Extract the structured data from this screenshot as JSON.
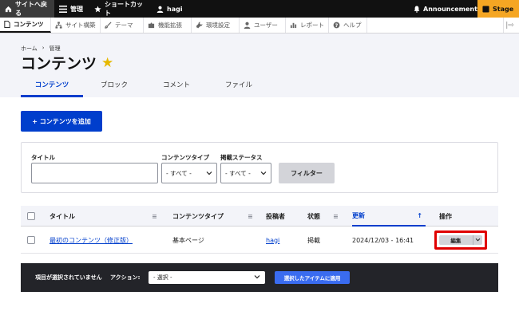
{
  "toolbar": {
    "back_label": "サイトへ戻る",
    "manage_label": "管理",
    "shortcuts_label": "ショートカット",
    "user_label": "hagi",
    "announcements_label": "Announcements",
    "stage_label": "Stage"
  },
  "tray": {
    "items": [
      "コンテンツ",
      "サイト構築",
      "テーマ",
      "機能拡張",
      "環境設定",
      "ユーザー",
      "レポート",
      "ヘルプ"
    ]
  },
  "header": {
    "breadcrumb": [
      "ホーム",
      "管理"
    ],
    "breadcrumb_sep": "›",
    "title": "コンテンツ",
    "star": "★",
    "tabs": [
      "コンテンツ",
      "ブロック",
      "コメント",
      "ファイル"
    ]
  },
  "main": {
    "add_button": "+ コンテンツを追加"
  },
  "filter": {
    "title_label": "タイトル",
    "title_value": "",
    "type_label": "コンテンツタイプ",
    "type_value": "- すべて -",
    "status_label": "掲載ステータス",
    "status_value": "- すべて -",
    "submit": "フィルター"
  },
  "table": {
    "headers": {
      "title": "タイトル",
      "type": "コンテンツタイプ",
      "author": "投稿者",
      "status": "状態",
      "updated": "更新",
      "operations": "操作"
    },
    "rows": [
      {
        "title": "最初のコンテンツ（修正版）",
        "type": "基本ページ",
        "author": "hagi",
        "status": "掲載",
        "updated": "2024/12/03 - 16:41",
        "edit": "編集"
      }
    ]
  },
  "bulk": {
    "none_selected": "項目が選択されていません",
    "action_label": "アクション:",
    "action_value": "- 選択 -",
    "apply": "選択したアイテムに適用"
  },
  "colors": {
    "primary": "#003ecc",
    "toolbar_bg": "#111111",
    "stage": "#f5a623",
    "highlight": "#e00000"
  }
}
